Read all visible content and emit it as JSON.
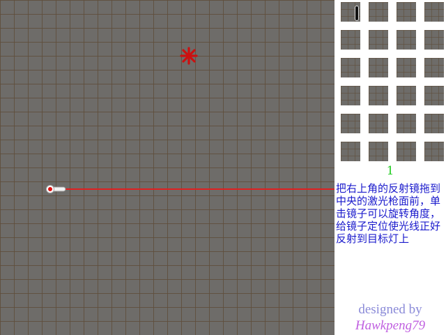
{
  "game": {
    "level": "1",
    "instructions": "把右上角的反射镜拖到中央的激光枪面前，单击镜子可以旋转角度，给镜子定位使光线正好反射到目标灯上",
    "credit_line1": "designed by",
    "credit_line2": "Hawkpeng79"
  },
  "tray": {
    "columns": 4,
    "rows": 6,
    "mirror_count": 1
  },
  "colors": {
    "board": "#6e6c69",
    "grid_lines": "#5f4e3a",
    "laser_beam": "#e02020",
    "target": "#cc1010",
    "level_text": "#22cc22",
    "instructions_text": "#1a1acc",
    "credit_line1": "#8a8ad8",
    "credit_line2": "#c060e0"
  },
  "icons": {
    "laser_gun": "laser-gun-icon",
    "target": "target-star-icon",
    "mirror": "mirror-icon"
  }
}
